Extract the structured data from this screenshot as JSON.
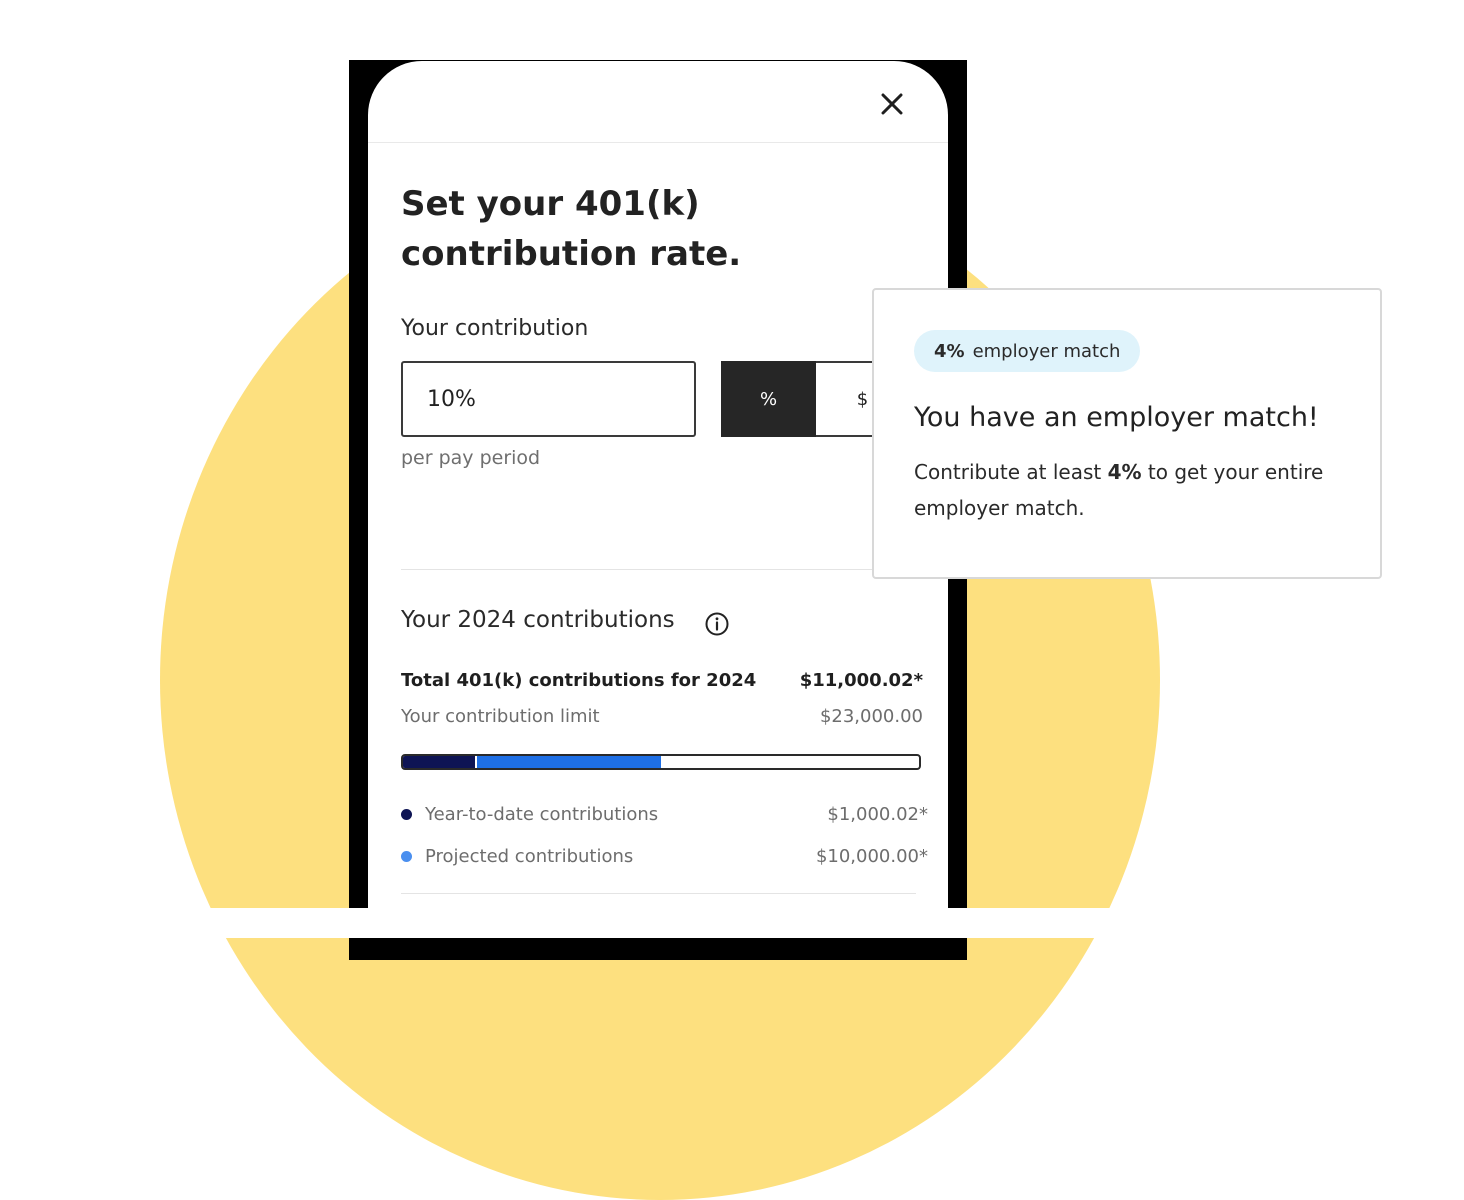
{
  "dialog": {
    "title_line1": "Set your 401(k)",
    "title_line2": "contribution rate."
  },
  "contribution": {
    "label": "Your contribution",
    "value": "10%",
    "toggle_percent": "%",
    "toggle_dollar": "$",
    "selected_unit": "%",
    "helper": "per pay period"
  },
  "summary": {
    "title": "Your 2024 contributions",
    "total_label": "Total 401(k) contributions for 2024",
    "total_value": "$11,000.02*",
    "limit_label": "Your contribution limit",
    "limit_value": "$23,000.00",
    "progress": {
      "ytd_fraction": 0.14,
      "projected_fraction": 0.5
    },
    "legend": [
      {
        "label": "Year-to-date contributions",
        "value": "$1,000.02*",
        "color": "#0e1454"
      },
      {
        "label": "Projected contributions",
        "value": "$10,000.00*",
        "color": "#4a8fef"
      }
    ]
  },
  "match_card": {
    "badge_pct": "4%",
    "badge_text": "employer match",
    "title": "You have an employer match!",
    "body_pre": "Contribute at least ",
    "body_pct": "4%",
    "body_post": " to get your entire employer match."
  },
  "icons": {
    "close": "close-icon",
    "info": "info-icon"
  },
  "colors": {
    "accent_yellow": "#fde07f",
    "progress_ytd": "#0e1454",
    "progress_projected": "#1e6fe5",
    "badge_bg": "#dff3fb"
  }
}
